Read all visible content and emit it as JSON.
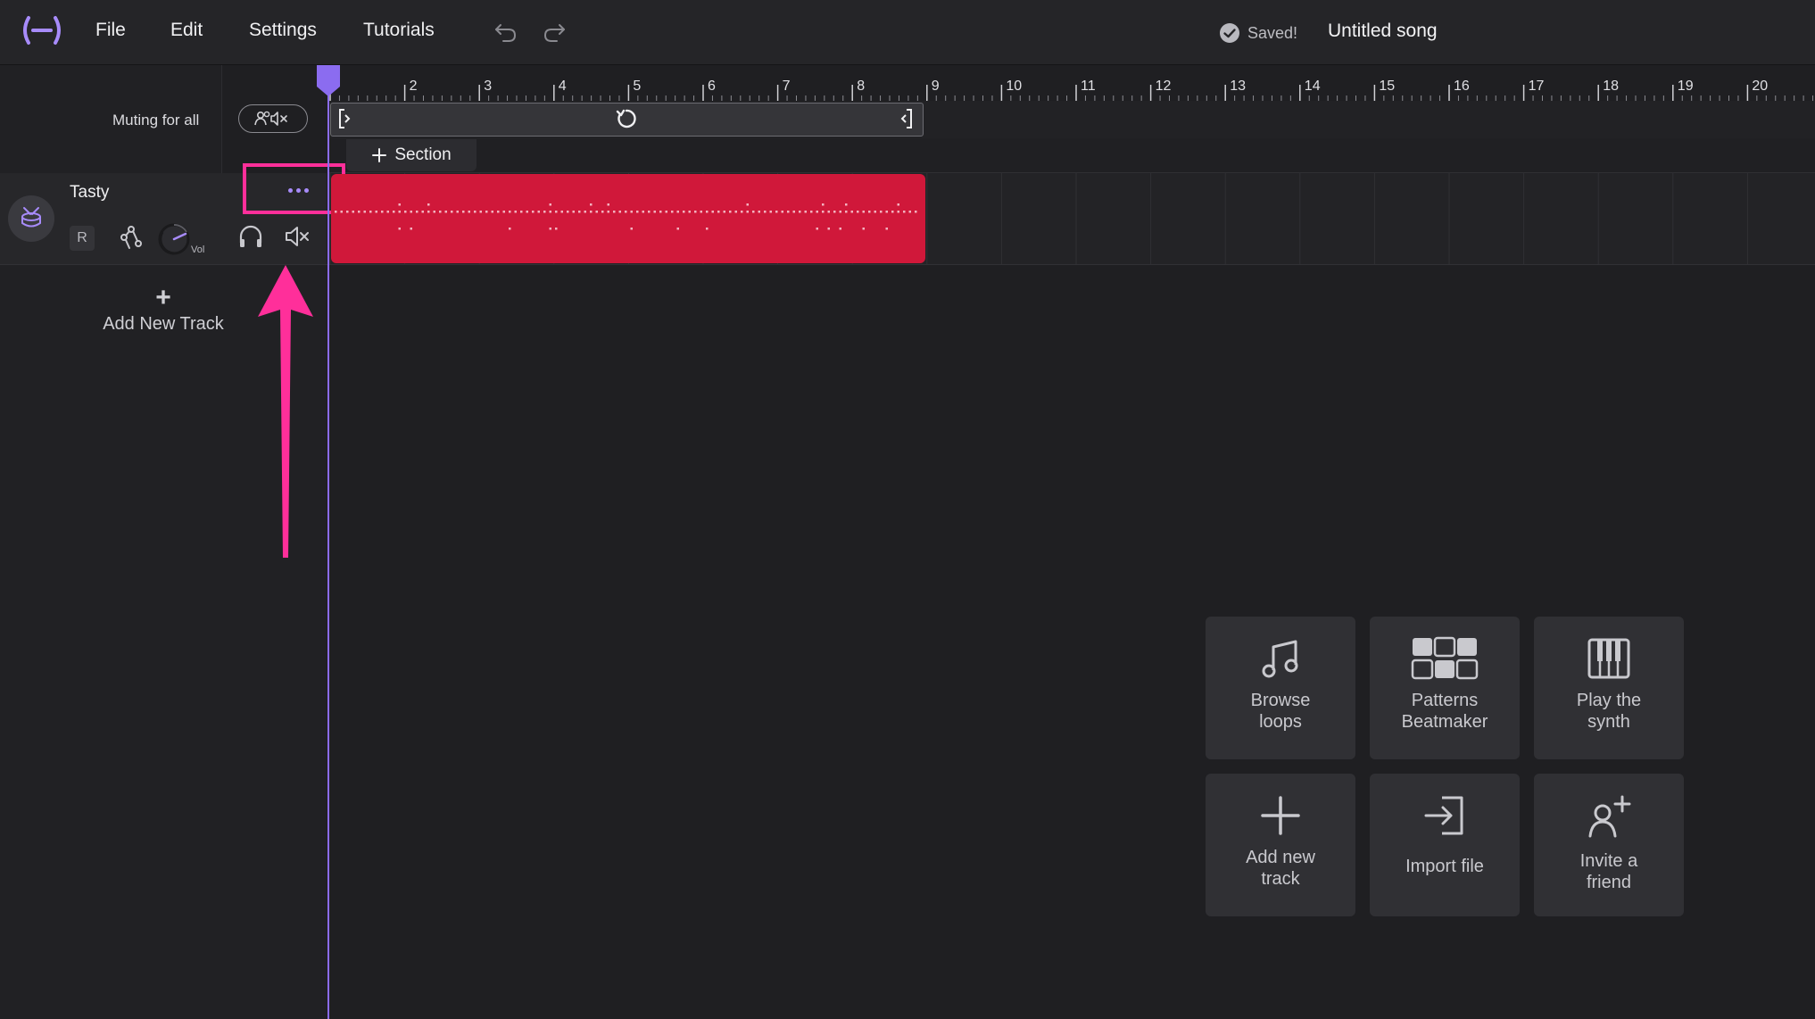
{
  "topbar": {
    "menus": [
      "File",
      "Edit",
      "Settings",
      "Tutorials"
    ],
    "saved_status": "Saved!",
    "song_title": "Untitled song"
  },
  "timeline": {
    "bar_numbers": [
      "2",
      "3",
      "4",
      "5",
      "6",
      "7",
      "8",
      "9",
      "10",
      "11",
      "12",
      "13",
      "14",
      "15",
      "16",
      "17",
      "18",
      "19",
      "20"
    ],
    "muting_label": "Muting for all",
    "add_section_label": "Section"
  },
  "track": {
    "name": "Tasty",
    "record_label": "R",
    "volume_label": "Vol",
    "clip_color": "#d0183a"
  },
  "left": {
    "add_track_label": "Add New Track"
  },
  "tiles": [
    {
      "id": "browse",
      "label": "Browse\nloops",
      "icon": "music-note-icon"
    },
    {
      "id": "patterns",
      "label": "Patterns\nBeatmaker",
      "icon": "grid-icon"
    },
    {
      "id": "synth",
      "label": "Play the\nsynth",
      "icon": "piano-icon"
    },
    {
      "id": "addtrack",
      "label": "Add new\ntrack",
      "icon": "plus-icon"
    },
    {
      "id": "import",
      "label": "Import file",
      "icon": "import-icon"
    },
    {
      "id": "invite",
      "label": "Invite a\nfriend",
      "icon": "add-person-icon"
    }
  ],
  "colors": {
    "accent": "#8b6cf0",
    "highlight": "#ff2f9a",
    "background": "#1f1f22"
  }
}
